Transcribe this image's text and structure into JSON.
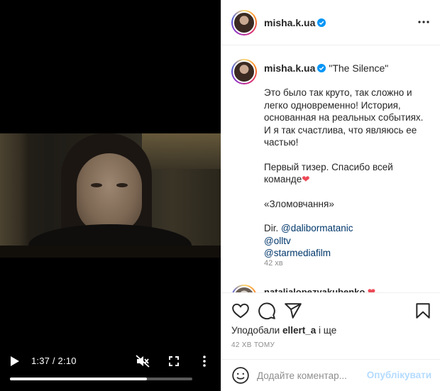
{
  "video": {
    "time_display": "1:37 / 2:10",
    "progress_fraction": 0.75
  },
  "header": {
    "username": "misha.k.ua"
  },
  "caption": {
    "username": "misha.k.ua",
    "title": "\"The Silence\"",
    "paragraph1": "Это было так круто, так сложно и легко одновременно! История, основанная на реальных событиях. И я так счастлива, что являюсь ее частью!",
    "paragraph2": "Первый тизер. Спасибо всей команде",
    "heart": "❤",
    "paragraph3": "«Зломовчання»",
    "dir_prefix": "Dir. ",
    "mention1": "@dalibormatanic",
    "mention2": "@olltv",
    "mention3": "@starmediafilm",
    "time": "42 хв"
  },
  "comment2": {
    "username": "natalialopezyakubenko",
    "heart": "❤"
  },
  "likes": {
    "prefix": "Уподобали ",
    "user": "ellert_a",
    "suffix": " і ще"
  },
  "date": "42 ХВ ТОМУ",
  "add_comment": {
    "placeholder": "Додайте коментар...",
    "post_label": "Опублікувати"
  },
  "colors": {
    "verified": "#0095f6",
    "link": "#00376b",
    "heart": "#ed4956",
    "post_disabled": "#b3dbff"
  }
}
